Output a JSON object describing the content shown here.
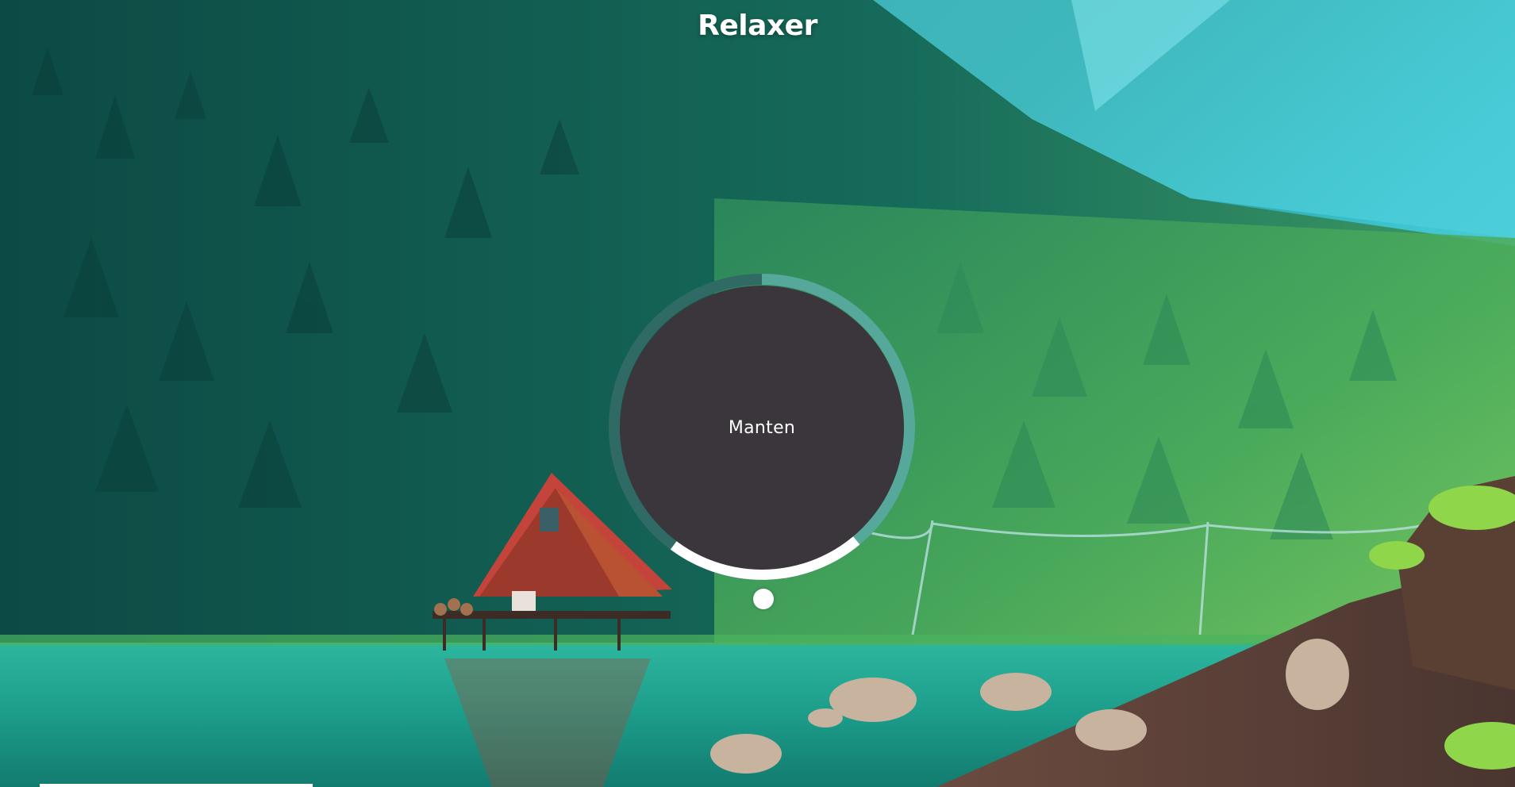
{
  "app": {
    "title": "Relaxer"
  },
  "breathing": {
    "instruction": "Manten"
  },
  "colors": {
    "ring_outer": "#2f6b64",
    "ring_inner": "#55a89a",
    "ring_hold": "#ffffff",
    "face": "#3a363b",
    "accent": "#ffffff"
  }
}
